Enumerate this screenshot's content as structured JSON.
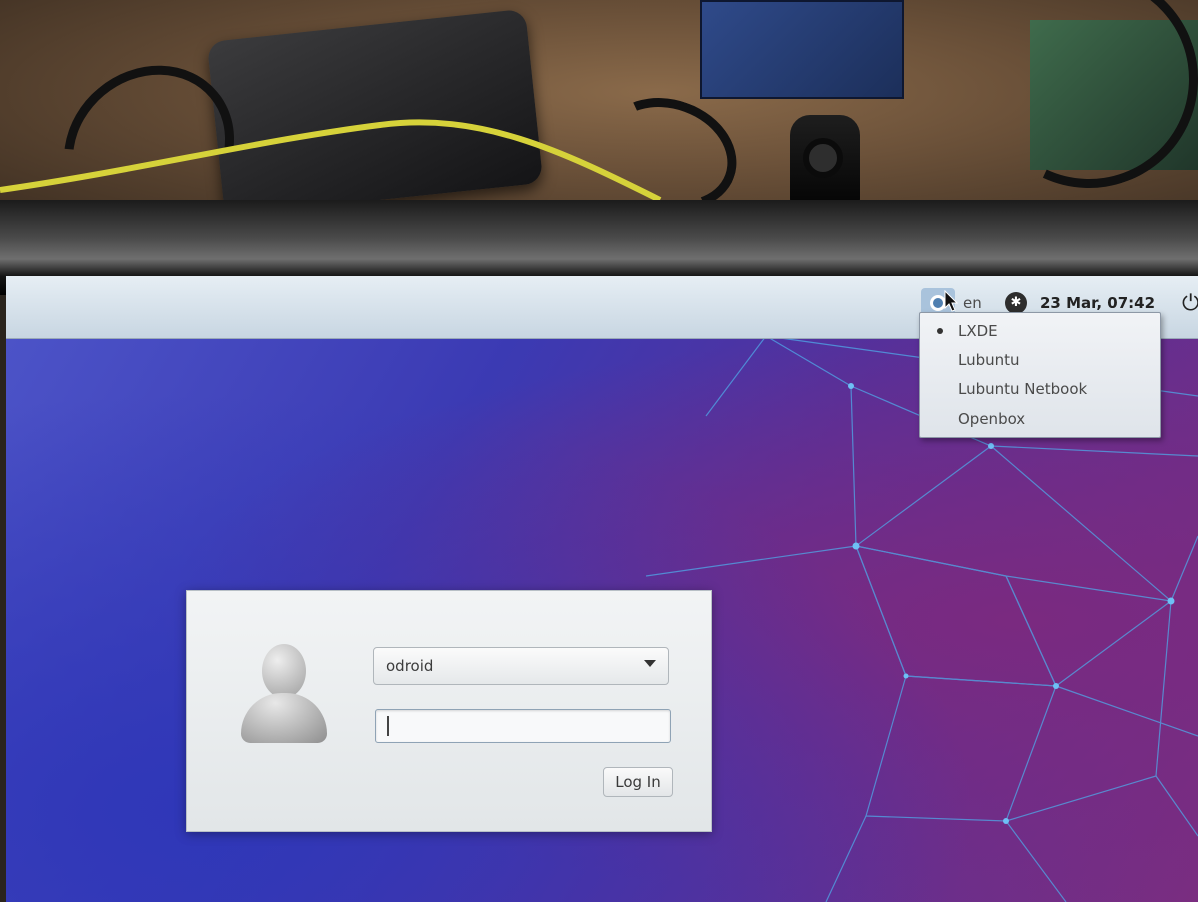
{
  "panel": {
    "language": "en",
    "clock": "23 Mar, 07:42"
  },
  "session_menu": {
    "items": [
      {
        "label": "LXDE",
        "selected": true
      },
      {
        "label": "Lubuntu",
        "selected": false
      },
      {
        "label": "Lubuntu Netbook",
        "selected": false
      },
      {
        "label": "Openbox",
        "selected": false
      }
    ]
  },
  "login": {
    "username": "odroid",
    "password": "",
    "button_label": "Log In"
  },
  "icons": {
    "session": "session-icon",
    "accessibility": "accessibility-icon",
    "power": "power-icon",
    "user": "user-avatar-icon",
    "dropdown": "chevron-down-icon"
  },
  "colors": {
    "panel": "#dbe5ee",
    "wallpaper_blue": "#4d55c9",
    "wallpaper_purple": "#7a2d80",
    "mesh_lines": "#4fa8e8"
  }
}
